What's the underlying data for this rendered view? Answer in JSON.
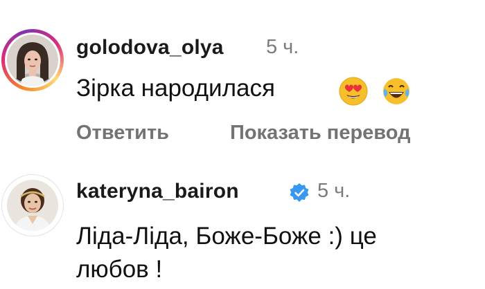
{
  "comments": [
    {
      "username": "golodova_olya",
      "time": "5 ч.",
      "text": "Зірка народилася",
      "emojis": [
        "heart-eyes-emoji",
        "tears-of-joy-emoji"
      ],
      "actions": {
        "reply": "Ответить",
        "translate": "Показать перевод"
      },
      "story_ring": true
    },
    {
      "username": "kateryna_bairon",
      "verified": true,
      "time": "5 ч.",
      "text_lines": [
        "Ліда-Ліда, Боже-Боже :) це",
        "любов !"
      ]
    }
  ],
  "colors": {
    "username": "#1a1a1a",
    "secondary": "#7b7b7b",
    "verified": "#3897f0"
  }
}
